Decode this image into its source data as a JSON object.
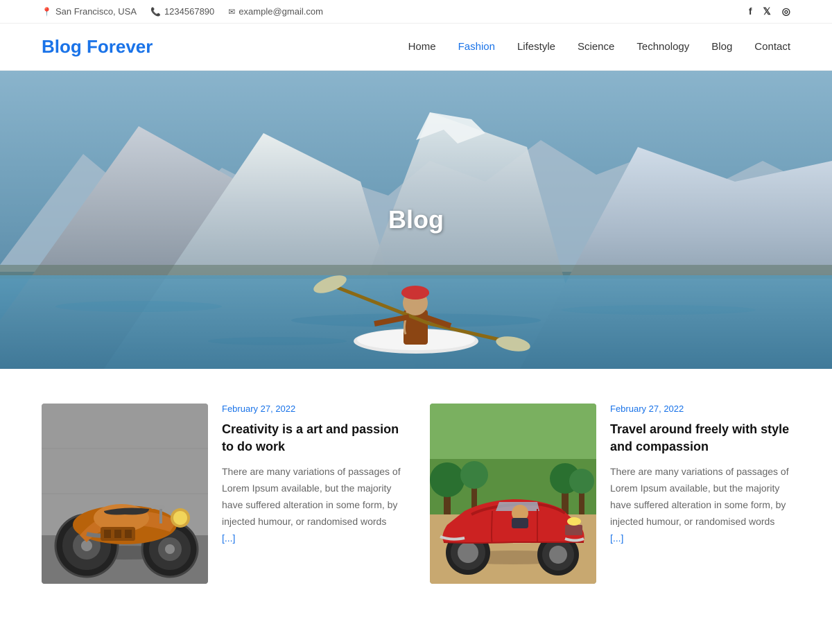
{
  "topbar": {
    "location": "San Francisco, USA",
    "phone": "1234567890",
    "email": "example@gmail.com",
    "socials": [
      {
        "name": "Facebook",
        "symbol": "f"
      },
      {
        "name": "Twitter",
        "symbol": "𝕏"
      },
      {
        "name": "Instagram",
        "symbol": "⊙"
      }
    ]
  },
  "header": {
    "logo": "Blog Forever",
    "nav": [
      {
        "label": "Home",
        "active": false
      },
      {
        "label": "Fashion",
        "active": true
      },
      {
        "label": "Lifestyle",
        "active": false
      },
      {
        "label": "Science",
        "active": false
      },
      {
        "label": "Technology",
        "active": false
      },
      {
        "label": "Blog",
        "active": false
      },
      {
        "label": "Contact",
        "active": false
      }
    ]
  },
  "hero": {
    "title": "Blog"
  },
  "cards": [
    {
      "date": "February 27, 2022",
      "title": "Creativity is a art and passion to do work",
      "body": "There are many variations of passages of Lorem Ipsum available, but the majority have suffered alteration in some form, by injected humour, or randomised words",
      "read_more": "[...]"
    },
    {
      "date": "February 27, 2022",
      "title": "Travel around freely with style and compassion",
      "body": "There are many variations of passages of Lorem Ipsum available, but the majority have suffered alteration in some form, by injected humour, or randomised words",
      "read_more": "[...]"
    }
  ]
}
